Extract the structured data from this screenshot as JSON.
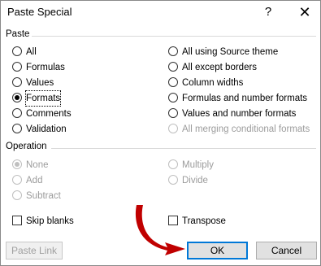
{
  "window": {
    "title": "Paste Special",
    "help_glyph": "?",
    "close_glyph": "✕"
  },
  "paste": {
    "label": "Paste",
    "left": [
      {
        "label": "All",
        "selected": false
      },
      {
        "label": "Formulas",
        "selected": false
      },
      {
        "label": "Values",
        "selected": false
      },
      {
        "label": "Formats",
        "selected": true
      },
      {
        "label": "Comments",
        "selected": false
      },
      {
        "label": "Validation",
        "selected": false
      }
    ],
    "right": [
      {
        "label": "All using Source theme",
        "disabled": false
      },
      {
        "label": "All except borders",
        "disabled": false
      },
      {
        "label": "Column widths",
        "disabled": false
      },
      {
        "label": "Formulas and number formats",
        "disabled": false
      },
      {
        "label": "Values and number formats",
        "disabled": false
      },
      {
        "label": "All merging conditional formats",
        "disabled": true
      }
    ]
  },
  "operation": {
    "label": "Operation",
    "left": [
      {
        "label": "None",
        "selected": true
      },
      {
        "label": "Add",
        "selected": false
      },
      {
        "label": "Subtract",
        "selected": false
      }
    ],
    "right": [
      {
        "label": "Multiply"
      },
      {
        "label": "Divide"
      }
    ]
  },
  "checks": {
    "skip_blanks": "Skip blanks",
    "transpose": "Transpose"
  },
  "buttons": {
    "paste_link": "Paste Link",
    "ok": "OK",
    "cancel": "Cancel"
  },
  "annotation": {
    "arrow_color": "#c00000"
  }
}
